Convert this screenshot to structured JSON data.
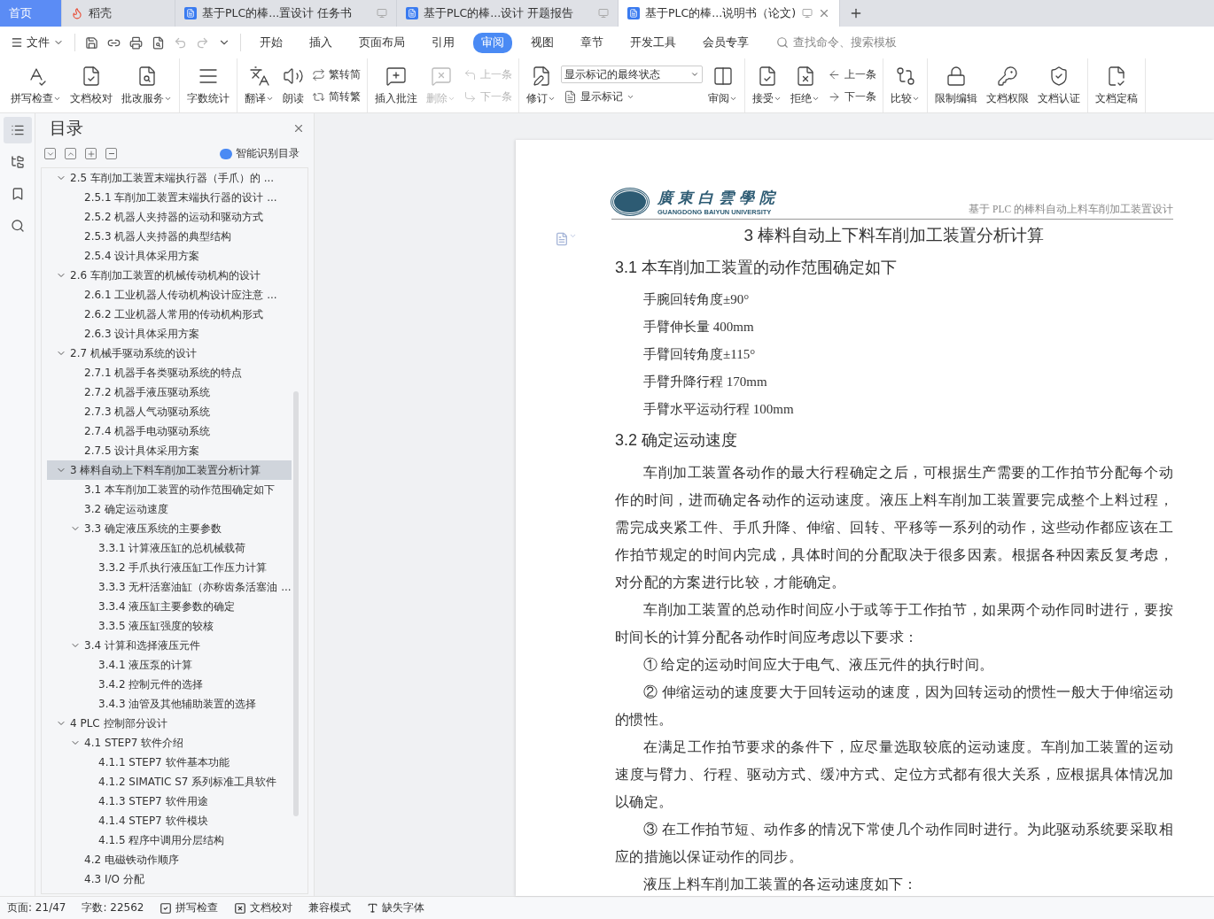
{
  "tabs": [
    {
      "label": "首页",
      "kind": "home",
      "selected": false
    },
    {
      "label": "稻壳",
      "kind": "app",
      "selected": false
    },
    {
      "label": "基于PLC的棒...置设计 任务书",
      "kind": "doc",
      "selected": false
    },
    {
      "label": "基于PLC的棒...设计 开题报告",
      "kind": "doc",
      "selected": false
    },
    {
      "label": "基于PLC的棒...说明书（论文)",
      "kind": "doc",
      "selected": true
    }
  ],
  "menu": {
    "file": "文件",
    "items": [
      {
        "label": "开始",
        "selected": false
      },
      {
        "label": "插入",
        "selected": false
      },
      {
        "label": "页面布局",
        "selected": false
      },
      {
        "label": "引用",
        "selected": false
      },
      {
        "label": "审阅",
        "selected": true
      },
      {
        "label": "视图",
        "selected": false
      },
      {
        "label": "章节",
        "selected": false
      },
      {
        "label": "开发工具",
        "selected": false
      },
      {
        "label": "会员专享",
        "selected": false
      }
    ],
    "search": {
      "placeholder": "查找命令、搜索模板"
    }
  },
  "ribbon": [
    {
      "items": [
        {
          "kind": "big",
          "label": "拼写检查",
          "caret": true
        },
        {
          "kind": "big",
          "label": "文档校对"
        },
        {
          "kind": "big",
          "label": "批改服务",
          "caret": true
        }
      ]
    },
    {
      "items": [
        {
          "kind": "big",
          "label": "字数统计"
        }
      ]
    },
    {
      "items": [
        {
          "kind": "big",
          "label": "翻译",
          "caret": true
        },
        {
          "kind": "big",
          "label": "朗读"
        },
        {
          "kind": "stack",
          "items": [
            {
              "kind": "small",
              "label": "繁转简"
            },
            {
              "kind": "small",
              "label": "简转繁"
            }
          ]
        }
      ]
    },
    {
      "items": [
        {
          "kind": "big",
          "label": "插入批注"
        },
        {
          "kind": "big",
          "label": "删除",
          "caret": true,
          "disabled": true
        },
        {
          "kind": "stack",
          "items": [
            {
              "kind": "small",
              "label": "上一条",
              "disabled": true
            },
            {
              "kind": "small",
              "label": "下一条",
              "disabled": true
            }
          ]
        }
      ]
    },
    {
      "items": [
        {
          "kind": "big",
          "label": "修订",
          "caret": true
        },
        {
          "kind": "stack",
          "items": [
            {
              "kind": "select",
              "label": "显示标记的最终状态"
            },
            {
              "kind": "small",
              "label": "显示标记",
              "caret": true
            }
          ]
        },
        {
          "kind": "big",
          "label": "审阅",
          "caret": true
        }
      ]
    },
    {
      "items": [
        {
          "kind": "big",
          "label": "接受",
          "caret": true
        },
        {
          "kind": "big",
          "label": "拒绝",
          "caret": true
        },
        {
          "kind": "stack",
          "items": [
            {
              "kind": "small",
              "label": "上一条"
            },
            {
              "kind": "small",
              "label": "下一条"
            }
          ]
        }
      ]
    },
    {
      "items": [
        {
          "kind": "big",
          "label": "比较",
          "caret": true
        }
      ]
    },
    {
      "items": [
        {
          "kind": "big",
          "label": "限制编辑"
        },
        {
          "kind": "big",
          "label": "文档权限"
        },
        {
          "kind": "big",
          "label": "文档认证"
        }
      ]
    },
    {
      "items": [
        {
          "kind": "big",
          "label": "文档定稿"
        }
      ]
    }
  ],
  "sidebar": {
    "title": "目录",
    "smart_button": "智能识别目录",
    "toc": [
      {
        "children": [
          {
            "label": "2.5 车削加工装置末端执行器（手爪）的 ...",
            "expanded": true,
            "selected": false,
            "children": [
              {
                "label": "2.5.1 车削加工装置末端执行器的设计 ...",
                "selected": false
              },
              {
                "label": "2.5.2 机器人夹持器的运动和驱动方式",
                "selected": false
              },
              {
                "label": "2.5.3  机器人夹持器的典型结构",
                "selected": false
              },
              {
                "label": "2.5.4  设计具体采用方案",
                "selected": false
              }
            ]
          },
          {
            "label": "2.6 车削加工装置的机械传动机构的设计",
            "expanded": true,
            "selected": false,
            "children": [
              {
                "label": "2.6.1 工业机器人传动机构设计应注意 ...",
                "selected": false
              },
              {
                "label": "2.6.2 工业机器人常用的传动机构形式",
                "selected": false
              },
              {
                "label": "2.6.3  设计具体采用方案",
                "selected": false
              }
            ]
          },
          {
            "label": "2.7 机械手驱动系统的设计",
            "expanded": true,
            "selected": false,
            "children": [
              {
                "label": "2.7.1 机器手各类驱动系统的特点",
                "selected": false
              },
              {
                "label": "2.7.2 机器手液压驱动系统",
                "selected": false
              },
              {
                "label": "2.7.3  机器人气动驱动系统",
                "selected": false
              },
              {
                "label": "2.7.4 机器手电动驱动系统",
                "selected": false
              },
              {
                "label": "2.7.5 设计具体采用方案",
                "selected": false
              }
            ]
          }
        ]
      },
      {
        "label": "3  棒料自动上下料车削加工装置分析计算",
        "expanded": true,
        "selected": true,
        "children": [
          {
            "label": "3.1 本车削加工装置的动作范围确定如下",
            "selected": false
          },
          {
            "label": "3.2 确定运动速度",
            "selected": false
          },
          {
            "label": "3.3 确定液压系统的主要参数",
            "expanded": true,
            "selected": false,
            "children": [
              {
                "label": "3.3.1 计算液压缸的总机械载荷",
                "selected": false
              },
              {
                "label": "3.3.2 手爪执行液压缸工作压力计算",
                "selected": false
              },
              {
                "label": "3.3.3  无杆活塞油缸（亦称齿条活塞油 ...",
                "selected": false
              },
              {
                "label": "3.3.4 液压缸主要参数的确定",
                "selected": false
              },
              {
                "label": "3.3.5 液压缸强度的较核",
                "selected": false
              }
            ]
          },
          {
            "label": "3.4 计算和选择液压元件",
            "expanded": true,
            "selected": false,
            "children": [
              {
                "label": "3.4.1 液压泵的计算",
                "selected": false
              },
              {
                "label": "3.4.2 控制元件的选择",
                "selected": false
              },
              {
                "label": "3.4.3 油管及其他辅助装置的选择",
                "selected": false
              }
            ]
          }
        ]
      },
      {
        "label": "4 PLC 控制部分设计",
        "expanded": true,
        "selected": false,
        "children": [
          {
            "label": "4.1 STEP7 软件介绍",
            "expanded": true,
            "selected": false,
            "children": [
              {
                "label": "4.1.1 STEP7 软件基本功能",
                "selected": false
              },
              {
                "label": "4.1.2 SIMATIC S7 系列标准工具软件",
                "selected": false
              },
              {
                "label": "4.1.3 STEP7 软件用途",
                "selected": false
              },
              {
                "label": "4.1.4 STEP7 软件模块",
                "selected": false
              },
              {
                "label": "4.1.5  程序中调用分层结构",
                "selected": false
              }
            ]
          },
          {
            "label": "4.2 电磁铁动作顺序",
            "selected": false
          },
          {
            "label": "4.3 I/O 分配",
            "selected": false
          }
        ]
      }
    ]
  },
  "document": {
    "header": {
      "logo_name": "廣東白雲學院",
      "logo_subtitle": "GUANGDONG BAIYUN UNIVERSITY",
      "title": "基于 PLC 的棒料自动上料车削加工装置设计"
    },
    "blocks": [
      {
        "kind": "h1",
        "text": "3  棒料自动上下料车削加工装置分析计算"
      },
      {
        "kind": "h2",
        "text": "3.1 本车削加工装置的动作范围确定如下"
      },
      {
        "kind": "item",
        "text": "手腕回转角度±90°"
      },
      {
        "kind": "item",
        "text": "手臂伸长量  400mm"
      },
      {
        "kind": "item",
        "text": "手臂回转角度±115°"
      },
      {
        "kind": "item",
        "text": "手臂升降行程  170mm"
      },
      {
        "kind": "item",
        "text": "手臂水平运动行程  100mm"
      },
      {
        "kind": "h2",
        "text": "3.2 确定运动速度"
      },
      {
        "kind": "para",
        "text": "车削加工装置各动作的最大行程确定之后，可根据生产需要的工作拍节分配每个动作的时间，进而确定各动作的运动速度。液压上料车削加工装置要完成整个上料过程，需完成夹紧工件、手爪升降、伸缩、回转、平移等一系列的动作，这些动作都应该在工作拍节规定的时间内完成，具体时间的分配取决于很多因素。根据各种因素反复考虑，对分配的方案进行比较，才能确定。"
      },
      {
        "kind": "para",
        "text": "车削加工装置的总动作时间应小于或等于工作拍节，如果两个动作同时进行，要按时间长的计算分配各动作时间应考虑以下要求："
      },
      {
        "kind": "para",
        "text": "① 给定的运动时间应大于电气、液压元件的执行时间。"
      },
      {
        "kind": "para",
        "text": "② 伸缩运动的速度要大于回转运动的速度，因为回转运动的惯性一般大于伸缩运动的惯性。"
      },
      {
        "kind": "para",
        "text": "在满足工作拍节要求的条件下，应尽量选取较底的运动速度。车削加工装置的运动速度与臂力、行程、驱动方式、缓冲方式、定位方式都有很大关系，应根据具体情况加以确定。"
      },
      {
        "kind": "para",
        "text": "③ 在工作拍节短、动作多的情况下常使几个动作同时进行。为此驱动系统要采取相应的措施以保证动作的同步。"
      },
      {
        "kind": "para",
        "text": "液压上料车削加工装置的各运动速度如下："
      }
    ]
  },
  "status_bar": [
    {
      "kind": "text",
      "label": "页面: 21/47"
    },
    {
      "kind": "text",
      "label": "字数: 22562"
    },
    {
      "kind": "check",
      "label": "拼写检查"
    },
    {
      "kind": "proof",
      "label": "文档校对"
    },
    {
      "kind": "text",
      "label": "兼容模式"
    },
    {
      "kind": "font",
      "label": "缺失字体"
    }
  ]
}
